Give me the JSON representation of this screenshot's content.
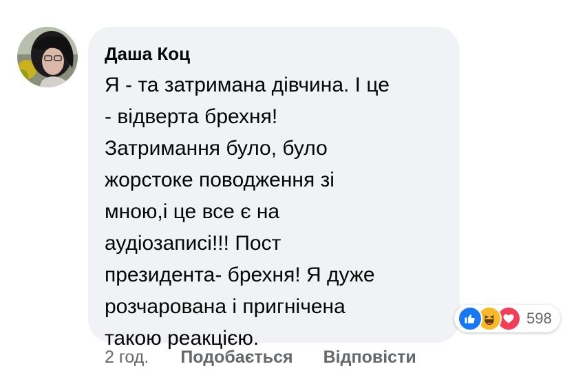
{
  "comment": {
    "author": "Даша Коц",
    "lines": [
      "Я - та затримана дівчина. І це",
      "- відверта брехня!",
      "Затримання було, було",
      "жорстоке поводження зі",
      "мною,і це все є на",
      "аудіозаписі!!! Пост",
      "президента- брехня! Я дуже",
      "розчарована і пригнічена",
      "такою реакцією."
    ]
  },
  "reactions": {
    "icons": [
      "like-icon",
      "haha-icon",
      "love-icon"
    ],
    "count": "598"
  },
  "actions": {
    "time": "2 год.",
    "like_label": "Подобається",
    "reply_label": "Відповісти"
  },
  "colors": {
    "bubble": "#f0f2f5",
    "text": "#050505",
    "secondary": "#65676b",
    "like": "#1877f2",
    "haha": "#f7b928",
    "love": "#f33e58"
  }
}
